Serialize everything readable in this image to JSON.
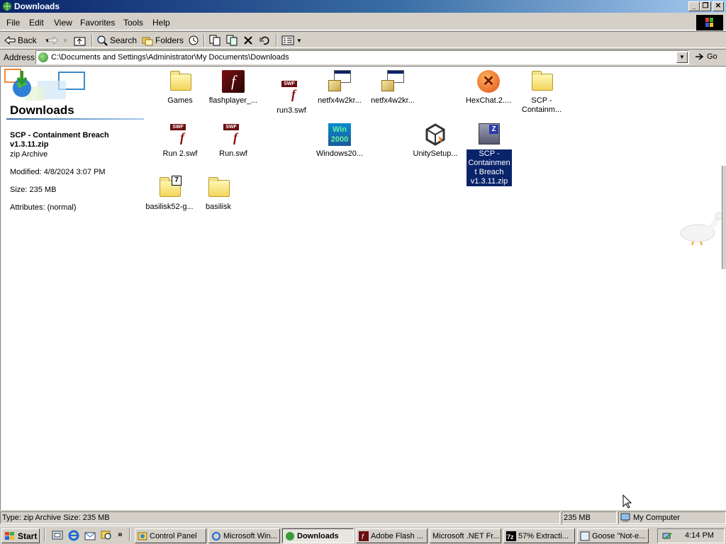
{
  "window": {
    "title": "Downloads",
    "buttons": {
      "minimize": "_",
      "restore": "❐",
      "close": "✕"
    }
  },
  "menu": [
    "File",
    "Edit",
    "View",
    "Favorites",
    "Tools",
    "Help"
  ],
  "toolbar": {
    "back": "Back",
    "search": "Search",
    "folders": "Folders"
  },
  "address": {
    "label": "Address",
    "path": "C:\\Documents and Settings\\Administrator\\My Documents\\Downloads",
    "go": "Go"
  },
  "left_pane": {
    "title": "Downloads",
    "selected_name": "SCP - Containment Breach v1.3.11.zip",
    "selected_type": "zip Archive",
    "modified": "Modified: 4/8/2024 3:07 PM",
    "size": "Size: 235 MB",
    "attributes": "Attributes: (normal)"
  },
  "files": [
    {
      "name": "Games",
      "icon": "folder-icon"
    },
    {
      "name": "flashplayer_...",
      "icon": "flash-player-icon"
    },
    {
      "name": "run3.swf",
      "icon": "swf-file-icon"
    },
    {
      "name": "netfx4w2kr...",
      "icon": "installer-icon"
    },
    {
      "name": "netfx4w2kr...",
      "icon": "installer-icon"
    },
    {
      "name": "HexChat.2....",
      "icon": "hexchat-icon"
    },
    {
      "name": "SCP - Containm...",
      "icon": "folder-icon"
    },
    {
      "name": "Run 2.swf",
      "icon": "swf-file-icon"
    },
    {
      "name": "Run.swf",
      "icon": "swf-file-icon"
    },
    {
      "name": "Windows20...",
      "icon": "windows-2000-icon"
    },
    {
      "name": "UnitySetup...",
      "icon": "unity-icon"
    },
    {
      "name": "SCP - Containment Breach v1.3.11.zip",
      "icon": "zip-archive-icon",
      "selected": true
    },
    {
      "name": "basilisk52-g...",
      "icon": "7zip-folder-icon"
    },
    {
      "name": "basilisk",
      "icon": "folder-icon"
    }
  ],
  "status": {
    "info": "Type: zip Archive Size: 235 MB",
    "size": "235 MB",
    "zone": "My Computer"
  },
  "taskbar": {
    "start": "Start",
    "quicklaunch_more": "»",
    "tasks": [
      {
        "label": "Control Panel",
        "icon": "control-panel-icon"
      },
      {
        "label": "Microsoft Win...",
        "icon": "ie-icon"
      },
      {
        "label": "Downloads",
        "icon": "explorer-icon",
        "active": true
      },
      {
        "label": "Adobe Flash ...",
        "icon": "flash-icon"
      },
      {
        "label": "Microsoft .NET Fr...",
        "icon": ""
      },
      {
        "label": "57% Extracti...",
        "icon": "7zip-icon"
      },
      {
        "label": "Goose \"Not-e...",
        "icon": "goose-icon"
      }
    ],
    "clock": "4:14 PM"
  },
  "colors": {
    "titlebar_start": "#0a246a",
    "titlebar_end": "#a6caf0",
    "selection": "#0a246a",
    "chrome": "#d4d0c8"
  }
}
